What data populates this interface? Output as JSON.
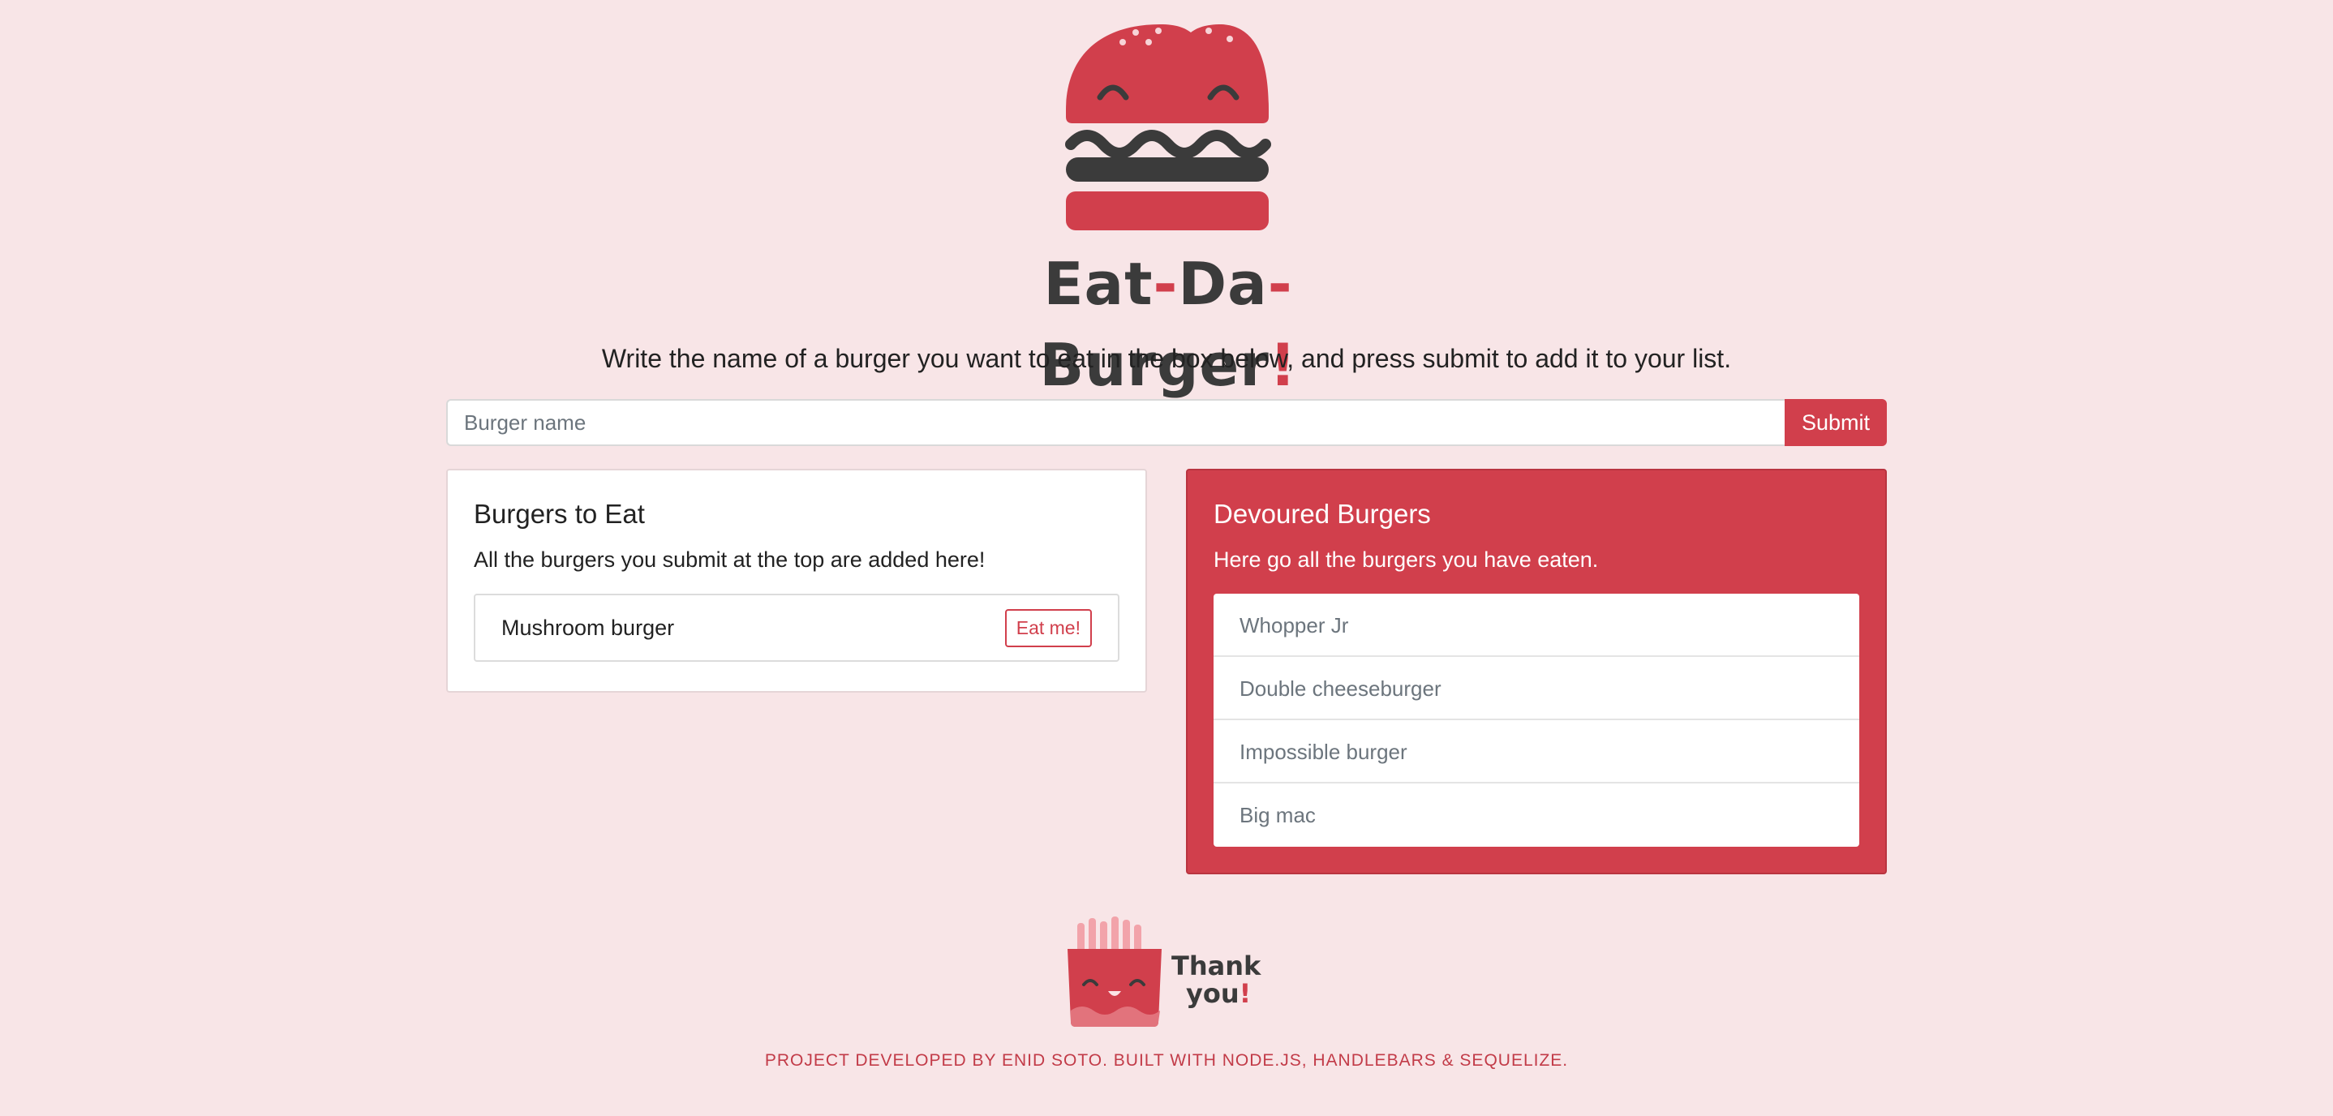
{
  "brand": {
    "part1": "Eat",
    "dash1": "-",
    "part2": "Da",
    "dash2": "-",
    "part3": "Burger",
    "bang": "!"
  },
  "intro": "Write the name of a burger you want to eat in the box below, and press submit to add it to your list.",
  "form": {
    "placeholder": "Burger name",
    "value": "",
    "submit_label": "Submit"
  },
  "to_eat": {
    "title": "Burgers to Eat",
    "text": "All the burgers you submit at the top are added here!",
    "items": [
      {
        "name": "Mushroom burger",
        "button": "Eat me!"
      }
    ]
  },
  "devoured": {
    "title": "Devoured Burgers",
    "text": "Here go all the burgers you have eaten.",
    "items": [
      "Whopper Jr",
      "Double cheeseburger",
      "Impossible burger",
      "Big mac"
    ]
  },
  "thanks": {
    "line1": "Thank",
    "line2": "you",
    "bang": "!"
  },
  "footer": "PROJECT DEVELOPED BY ENID SOTO. BUILT WITH NODE.JS, HANDLEBARS & SEQUELIZE.",
  "colors": {
    "background": "#f8e5e7",
    "accent": "#d13f4c",
    "dark": "#3b3b3b"
  },
  "icons": {
    "logo": "burger-logo-icon",
    "thanks": "fries-icon"
  }
}
